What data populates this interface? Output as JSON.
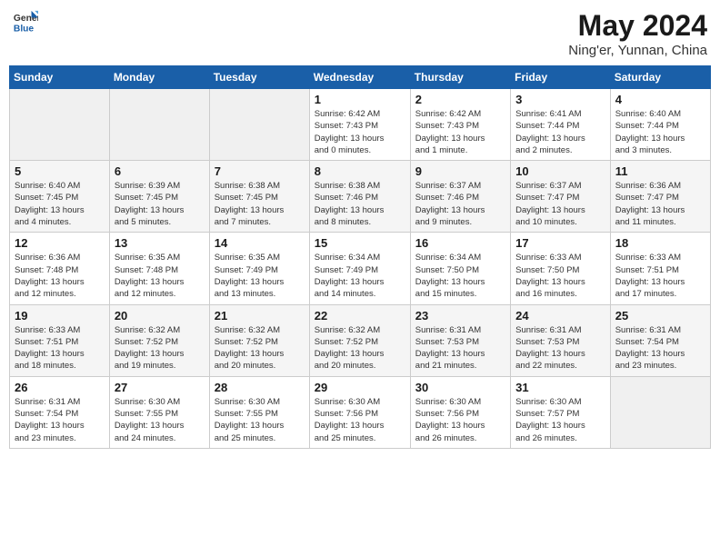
{
  "header": {
    "logo_general": "General",
    "logo_blue": "Blue",
    "title": "May 2024",
    "subtitle": "Ning'er, Yunnan, China"
  },
  "days_of_week": [
    "Sunday",
    "Monday",
    "Tuesday",
    "Wednesday",
    "Thursday",
    "Friday",
    "Saturday"
  ],
  "weeks": [
    [
      {
        "day": "",
        "info": ""
      },
      {
        "day": "",
        "info": ""
      },
      {
        "day": "",
        "info": ""
      },
      {
        "day": "1",
        "info": "Sunrise: 6:42 AM\nSunset: 7:43 PM\nDaylight: 13 hours\nand 0 minutes."
      },
      {
        "day": "2",
        "info": "Sunrise: 6:42 AM\nSunset: 7:43 PM\nDaylight: 13 hours\nand 1 minute."
      },
      {
        "day": "3",
        "info": "Sunrise: 6:41 AM\nSunset: 7:44 PM\nDaylight: 13 hours\nand 2 minutes."
      },
      {
        "day": "4",
        "info": "Sunrise: 6:40 AM\nSunset: 7:44 PM\nDaylight: 13 hours\nand 3 minutes."
      }
    ],
    [
      {
        "day": "5",
        "info": "Sunrise: 6:40 AM\nSunset: 7:45 PM\nDaylight: 13 hours\nand 4 minutes."
      },
      {
        "day": "6",
        "info": "Sunrise: 6:39 AM\nSunset: 7:45 PM\nDaylight: 13 hours\nand 5 minutes."
      },
      {
        "day": "7",
        "info": "Sunrise: 6:38 AM\nSunset: 7:45 PM\nDaylight: 13 hours\nand 7 minutes."
      },
      {
        "day": "8",
        "info": "Sunrise: 6:38 AM\nSunset: 7:46 PM\nDaylight: 13 hours\nand 8 minutes."
      },
      {
        "day": "9",
        "info": "Sunrise: 6:37 AM\nSunset: 7:46 PM\nDaylight: 13 hours\nand 9 minutes."
      },
      {
        "day": "10",
        "info": "Sunrise: 6:37 AM\nSunset: 7:47 PM\nDaylight: 13 hours\nand 10 minutes."
      },
      {
        "day": "11",
        "info": "Sunrise: 6:36 AM\nSunset: 7:47 PM\nDaylight: 13 hours\nand 11 minutes."
      }
    ],
    [
      {
        "day": "12",
        "info": "Sunrise: 6:36 AM\nSunset: 7:48 PM\nDaylight: 13 hours\nand 12 minutes."
      },
      {
        "day": "13",
        "info": "Sunrise: 6:35 AM\nSunset: 7:48 PM\nDaylight: 13 hours\nand 12 minutes."
      },
      {
        "day": "14",
        "info": "Sunrise: 6:35 AM\nSunset: 7:49 PM\nDaylight: 13 hours\nand 13 minutes."
      },
      {
        "day": "15",
        "info": "Sunrise: 6:34 AM\nSunset: 7:49 PM\nDaylight: 13 hours\nand 14 minutes."
      },
      {
        "day": "16",
        "info": "Sunrise: 6:34 AM\nSunset: 7:50 PM\nDaylight: 13 hours\nand 15 minutes."
      },
      {
        "day": "17",
        "info": "Sunrise: 6:33 AM\nSunset: 7:50 PM\nDaylight: 13 hours\nand 16 minutes."
      },
      {
        "day": "18",
        "info": "Sunrise: 6:33 AM\nSunset: 7:51 PM\nDaylight: 13 hours\nand 17 minutes."
      }
    ],
    [
      {
        "day": "19",
        "info": "Sunrise: 6:33 AM\nSunset: 7:51 PM\nDaylight: 13 hours\nand 18 minutes."
      },
      {
        "day": "20",
        "info": "Sunrise: 6:32 AM\nSunset: 7:52 PM\nDaylight: 13 hours\nand 19 minutes."
      },
      {
        "day": "21",
        "info": "Sunrise: 6:32 AM\nSunset: 7:52 PM\nDaylight: 13 hours\nand 20 minutes."
      },
      {
        "day": "22",
        "info": "Sunrise: 6:32 AM\nSunset: 7:52 PM\nDaylight: 13 hours\nand 20 minutes."
      },
      {
        "day": "23",
        "info": "Sunrise: 6:31 AM\nSunset: 7:53 PM\nDaylight: 13 hours\nand 21 minutes."
      },
      {
        "day": "24",
        "info": "Sunrise: 6:31 AM\nSunset: 7:53 PM\nDaylight: 13 hours\nand 22 minutes."
      },
      {
        "day": "25",
        "info": "Sunrise: 6:31 AM\nSunset: 7:54 PM\nDaylight: 13 hours\nand 23 minutes."
      }
    ],
    [
      {
        "day": "26",
        "info": "Sunrise: 6:31 AM\nSunset: 7:54 PM\nDaylight: 13 hours\nand 23 minutes."
      },
      {
        "day": "27",
        "info": "Sunrise: 6:30 AM\nSunset: 7:55 PM\nDaylight: 13 hours\nand 24 minutes."
      },
      {
        "day": "28",
        "info": "Sunrise: 6:30 AM\nSunset: 7:55 PM\nDaylight: 13 hours\nand 25 minutes."
      },
      {
        "day": "29",
        "info": "Sunrise: 6:30 AM\nSunset: 7:56 PM\nDaylight: 13 hours\nand 25 minutes."
      },
      {
        "day": "30",
        "info": "Sunrise: 6:30 AM\nSunset: 7:56 PM\nDaylight: 13 hours\nand 26 minutes."
      },
      {
        "day": "31",
        "info": "Sunrise: 6:30 AM\nSunset: 7:57 PM\nDaylight: 13 hours\nand 26 minutes."
      },
      {
        "day": "",
        "info": ""
      }
    ]
  ]
}
